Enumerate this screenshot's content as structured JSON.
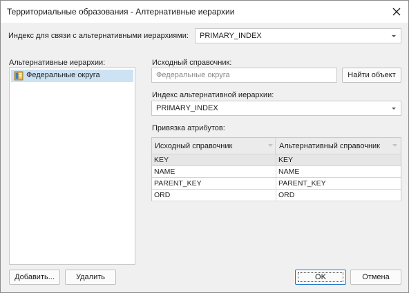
{
  "window": {
    "title": "Территориальные образования - Алтернативные иерархии",
    "close_icon": "close-icon"
  },
  "index_link": {
    "label": "Индекс для связи с альтернативными иерархиями:",
    "value": "PRIMARY_INDEX"
  },
  "hierarchies": {
    "label": "Альтернативные иерархии:",
    "items": [
      {
        "label": "Федеральные округа",
        "icon": "dictionary-icon",
        "selected": true
      }
    ]
  },
  "source_dictionary": {
    "label": "Исходный справочник:",
    "value": "Федеральные округа",
    "find_button": "Найти объект"
  },
  "alt_index": {
    "label": "Индекс альтернативной иерархии:",
    "value": "PRIMARY_INDEX"
  },
  "attributes": {
    "label": "Привязка атрибутов:",
    "columns": [
      "Исходный справочник",
      "Альтернативный справочник"
    ],
    "rows": [
      [
        "KEY",
        "KEY"
      ],
      [
        "NAME",
        "NAME"
      ],
      [
        "PARENT_KEY",
        "PARENT_KEY"
      ],
      [
        "ORD",
        "ORD"
      ]
    ]
  },
  "buttons": {
    "add": "Добавить...",
    "remove": "Удалить",
    "ok": "OK",
    "cancel": "Отмена"
  },
  "colors": {
    "selection": "#cde3f4",
    "accent": "#1a73c8",
    "background": "#f0f0f0"
  }
}
